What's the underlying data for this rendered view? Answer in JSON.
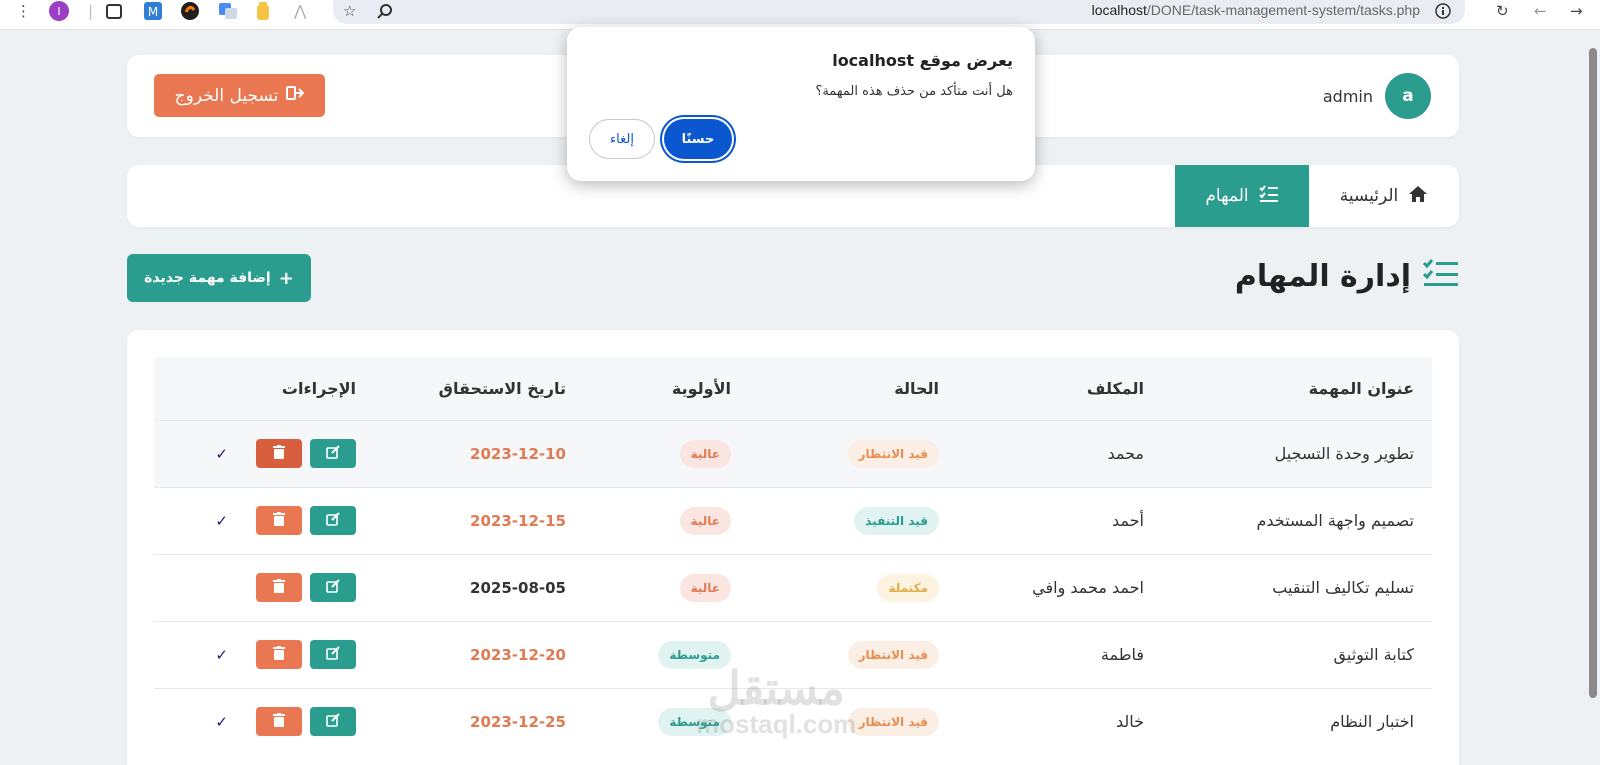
{
  "browser": {
    "url_host": "localhost",
    "url_path": "/DONE/task-management-system/tasks.php"
  },
  "header": {
    "logout_label": "تسجيل الخروج",
    "avatar_letter": "a",
    "username": "admin"
  },
  "nav": {
    "home_label": "الرئيسية",
    "tasks_label": "المهام"
  },
  "page": {
    "title": "إدارة المهام",
    "add_button_label": "إضافة مهمة جديدة"
  },
  "table": {
    "headers": [
      "عنوان المهمة",
      "المكلف",
      "الحالة",
      "الأولوية",
      "تاريخ الاستحقاق",
      "الإجراءات"
    ],
    "rows": [
      {
        "title": "تطوير وحدة التسجيل",
        "assignee": "محمد",
        "status": "قيد الانتظار",
        "priority": "عالية",
        "due": "2023-12-10"
      },
      {
        "title": "تصميم واجهة المستخدم",
        "assignee": "أحمد",
        "status": "قيد التنفيذ",
        "priority": "عالية",
        "due": "2023-12-15"
      },
      {
        "title": "تسليم تكاليف التنقيب",
        "assignee": "احمد محمد وافي",
        "status": "مكتملة",
        "priority": "عالية",
        "due": "2025-08-05"
      },
      {
        "title": "كتابة التوثيق",
        "assignee": "فاطمة",
        "status": "قيد الانتظار",
        "priority": "متوسطة",
        "due": "2023-12-20"
      },
      {
        "title": "اختبار النظام",
        "assignee": "خالد",
        "status": "قيد الانتظار",
        "priority": "متوسطة",
        "due": "2023-12-25"
      }
    ]
  },
  "dialog": {
    "title": "يعرض موقع localhost",
    "message": "هل أنت متأكد من حذف هذه المهمة؟",
    "ok_label": "حسنًا",
    "cancel_label": "إلغاء"
  },
  "watermark": {
    "line1": "مستقل",
    "line2": "mostaql.com"
  },
  "colors": {
    "accent": "#2a9d8f",
    "danger": "#e87752",
    "dialog_primary": "#0b57d0"
  }
}
